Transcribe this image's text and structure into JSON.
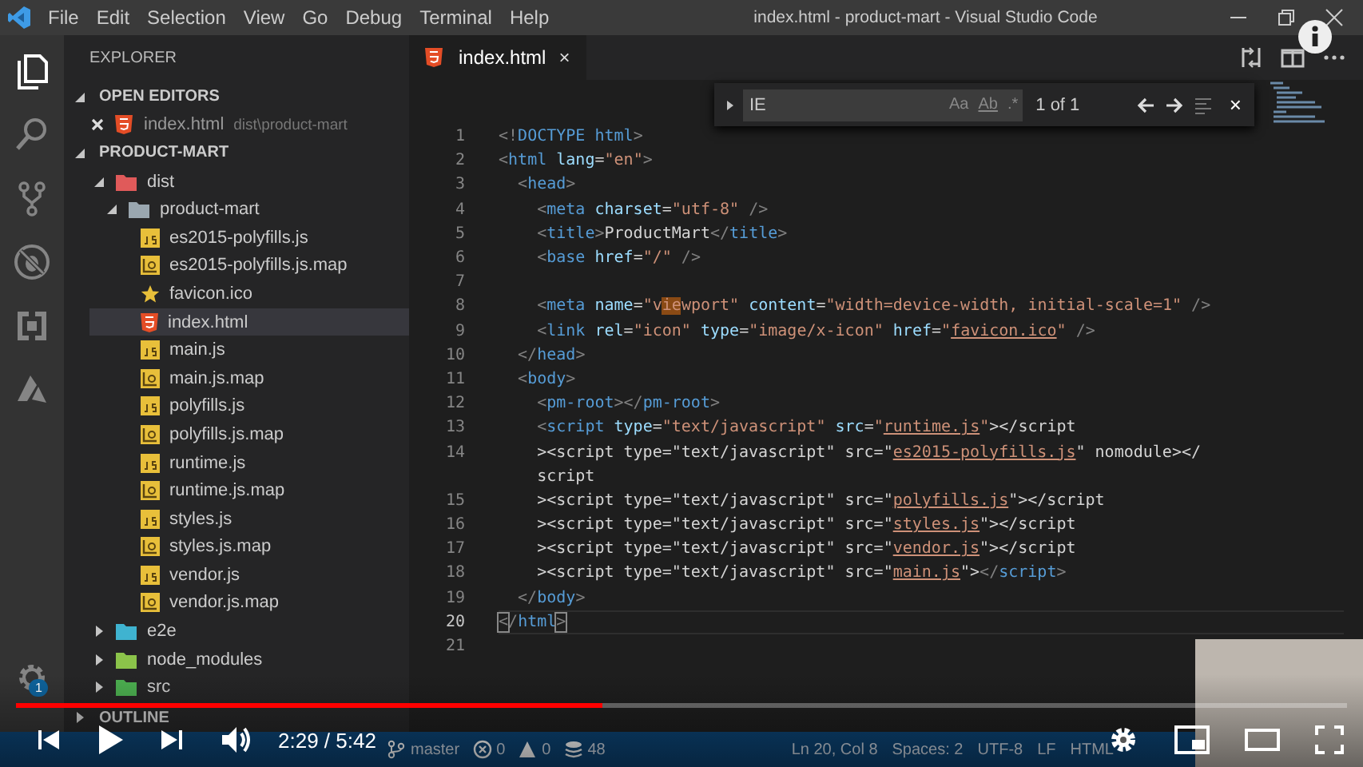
{
  "window": {
    "title": "index.html - product-mart - Visual Studio Code",
    "menu": [
      "File",
      "Edit",
      "Selection",
      "View",
      "Go",
      "Debug",
      "Terminal",
      "Help"
    ]
  },
  "activity_bar": {
    "items": [
      {
        "kind": "files",
        "selected": true
      },
      {
        "kind": "search",
        "selected": false
      },
      {
        "kind": "source-control",
        "selected": false
      },
      {
        "kind": "debug",
        "selected": false
      },
      {
        "kind": "extensions",
        "selected": false
      },
      {
        "kind": "azure",
        "selected": false
      }
    ],
    "settings_badge": "1"
  },
  "explorer": {
    "title": "EXPLORER",
    "open_editors": {
      "title": "OPEN EDITORS",
      "expanded": true,
      "items": [
        {
          "kind": "html",
          "name": "index.html",
          "path": "dist\\product-mart"
        }
      ]
    },
    "folder": {
      "title": "PRODUCT-MART",
      "expanded": true,
      "items": [
        {
          "kind": "folder",
          "name": "dist",
          "color": "#e05a5a",
          "expanded": true,
          "selected": false,
          "children": [
            {
              "kind": "folder",
              "name": "product-mart",
              "color": "#9aa7b0",
              "expanded": true,
              "selected": false,
              "children": [
                {
                  "kind": "js",
                  "name": "es2015-polyfills.js",
                  "selected": false
                },
                {
                  "kind": "map",
                  "name": "es2015-polyfills.js.map",
                  "selected": false
                },
                {
                  "kind": "favicon",
                  "name": "favicon.ico",
                  "selected": false
                },
                {
                  "kind": "html",
                  "name": "index.html",
                  "selected": true
                },
                {
                  "kind": "js",
                  "name": "main.js",
                  "selected": false
                },
                {
                  "kind": "map",
                  "name": "main.js.map",
                  "selected": false
                },
                {
                  "kind": "js",
                  "name": "polyfills.js",
                  "selected": false
                },
                {
                  "kind": "map",
                  "name": "polyfills.js.map",
                  "selected": false
                },
                {
                  "kind": "js",
                  "name": "runtime.js",
                  "selected": false
                },
                {
                  "kind": "map",
                  "name": "runtime.js.map",
                  "selected": false
                },
                {
                  "kind": "js",
                  "name": "styles.js",
                  "selected": false
                },
                {
                  "kind": "map",
                  "name": "styles.js.map",
                  "selected": false
                },
                {
                  "kind": "js",
                  "name": "vendor.js",
                  "selected": false
                },
                {
                  "kind": "map",
                  "name": "vendor.js.map",
                  "selected": false
                }
              ]
            }
          ]
        },
        {
          "kind": "folder",
          "name": "e2e",
          "color": "#3fb3d0",
          "expanded": false,
          "selected": false
        },
        {
          "kind": "folder",
          "name": "node_modules",
          "color": "#8bc34a",
          "expanded": false,
          "selected": false
        },
        {
          "kind": "folder",
          "name": "src",
          "color": "#4caf50",
          "expanded": false,
          "selected": false
        }
      ]
    },
    "outline": {
      "title": "OUTLINE",
      "expanded": false
    }
  },
  "editor": {
    "tabs": [
      {
        "kind": "html",
        "label": "index.html",
        "selected": true,
        "close": "×"
      }
    ],
    "find": {
      "query": "IE",
      "options": [
        "Aa",
        "Ab",
        ".*"
      ],
      "result": "1 of 1",
      "close": "×"
    },
    "lines": [
      {
        "number": "1",
        "current": false,
        "tokens": [
          {
            "kind": "p",
            "text": "<!"
          },
          {
            "kind": "tag",
            "text": "DOCTYPE"
          },
          {
            "kind": "tag",
            "text": " html"
          },
          {
            "kind": "p",
            "text": ">"
          }
        ]
      },
      {
        "number": "2",
        "current": false,
        "tokens": [
          {
            "kind": "p",
            "text": "<"
          },
          {
            "kind": "tag",
            "text": "html"
          },
          {
            "kind": "attr",
            "text": " lang"
          },
          {
            "kind": "t",
            "text": "="
          },
          {
            "kind": "str",
            "text": "\"en\""
          },
          {
            "kind": "p",
            "text": ">"
          }
        ]
      },
      {
        "number": "3",
        "current": false,
        "tokens": [
          {
            "kind": "p",
            "text": "  <"
          },
          {
            "kind": "tag",
            "text": "head"
          },
          {
            "kind": "p",
            "text": ">"
          }
        ]
      },
      {
        "number": "4",
        "current": false,
        "tokens": [
          {
            "kind": "p",
            "text": "    <"
          },
          {
            "kind": "tag",
            "text": "meta"
          },
          {
            "kind": "attr",
            "text": " charset"
          },
          {
            "kind": "t",
            "text": "="
          },
          {
            "kind": "str",
            "text": "\"utf-8\""
          },
          {
            "kind": "p",
            "text": " />"
          }
        ]
      },
      {
        "number": "5",
        "current": false,
        "tokens": [
          {
            "kind": "p",
            "text": "    <"
          },
          {
            "kind": "tag",
            "text": "title"
          },
          {
            "kind": "p",
            "text": ">"
          },
          {
            "kind": "t",
            "text": "ProductMart"
          },
          {
            "kind": "p",
            "text": "</"
          },
          {
            "kind": "tag",
            "text": "title"
          },
          {
            "kind": "p",
            "text": ">"
          }
        ]
      },
      {
        "number": "6",
        "current": false,
        "tokens": [
          {
            "kind": "p",
            "text": "    <"
          },
          {
            "kind": "tag",
            "text": "base"
          },
          {
            "kind": "attr",
            "text": " href"
          },
          {
            "kind": "t",
            "text": "="
          },
          {
            "kind": "str",
            "text": "\"/\""
          },
          {
            "kind": "p",
            "text": " />"
          }
        ]
      },
      {
        "number": "7",
        "current": false
      },
      {
        "number": "8",
        "current": false,
        "tokens": [
          {
            "kind": "p",
            "text": "    <"
          },
          {
            "kind": "tag",
            "text": "meta"
          },
          {
            "kind": "attr",
            "text": " name"
          },
          {
            "kind": "t",
            "text": "="
          },
          {
            "kind": "str",
            "text": "\"v"
          },
          {
            "kind": "match",
            "text": "ie"
          },
          {
            "kind": "str",
            "text": "wport\""
          },
          {
            "kind": "attr",
            "text": " content"
          },
          {
            "kind": "t",
            "text": "="
          },
          {
            "kind": "str",
            "text": "\"width=device-width, initial-scale=1\""
          },
          {
            "kind": "p",
            "text": " />"
          }
        ]
      },
      {
        "number": "9",
        "current": false,
        "tokens": [
          {
            "kind": "p",
            "text": "    <"
          },
          {
            "kind": "tag",
            "text": "link"
          },
          {
            "kind": "attr",
            "text": " rel"
          },
          {
            "kind": "t",
            "text": "="
          },
          {
            "kind": "str",
            "text": "\"icon\""
          },
          {
            "kind": "attr",
            "text": " type"
          },
          {
            "kind": "t",
            "text": "="
          },
          {
            "kind": "str",
            "text": "\"image/x-icon\""
          },
          {
            "kind": "attr",
            "text": " href"
          },
          {
            "kind": "t",
            "text": "="
          },
          {
            "kind": "str",
            "text": "\""
          },
          {
            "kind": "link",
            "text": "favicon.ico"
          },
          {
            "kind": "str",
            "text": "\""
          },
          {
            "kind": "p",
            "text": " />"
          }
        ]
      },
      {
        "number": "10",
        "current": false,
        "tokens": [
          {
            "kind": "p",
            "text": "  </"
          },
          {
            "kind": "tag",
            "text": "head"
          },
          {
            "kind": "p",
            "text": ">"
          }
        ]
      },
      {
        "number": "11",
        "current": false,
        "tokens": [
          {
            "kind": "p",
            "text": "  <"
          },
          {
            "kind": "tag",
            "text": "body"
          },
          {
            "kind": "p",
            "text": ">"
          }
        ]
      },
      {
        "number": "12",
        "current": false,
        "tokens": [
          {
            "kind": "p",
            "text": "    <"
          },
          {
            "kind": "tag",
            "text": "pm-root"
          },
          {
            "kind": "p",
            "text": "></"
          },
          {
            "kind": "tag",
            "text": "pm-root"
          },
          {
            "kind": "p",
            "text": ">"
          }
        ]
      },
      {
        "number": "13",
        "current": false,
        "tokens": [
          {
            "kind": "p",
            "text": "    <"
          },
          {
            "kind": "tag",
            "text": "script"
          },
          {
            "kind": "attr",
            "text": " type"
          },
          {
            "kind": "t",
            "text": "="
          },
          {
            "kind": "str",
            "text": "\"text/javascript\""
          },
          {
            "kind": "attr",
            "text": " src"
          },
          {
            "kind": "t",
            "text": "="
          },
          {
            "kind": "str",
            "text": "\""
          },
          {
            "kind": "link",
            "text": "runtime.js"
          },
          {
            "kind": "str",
            "text": "\""
          },
          {
            "kind": "t",
            "text": "></script"
          }
        ]
      },
      {
        "number": "14",
        "current": false,
        "tokens": [
          {
            "kind": "t",
            "text": "    ><script type=\"text/javascript\" src=\""
          },
          {
            "kind": "link",
            "text": "es2015-polyfills.js"
          },
          {
            "kind": "t",
            "text": "\" nomodule></"
          }
        ]
      },
      {
        "current": false,
        "tokens": [
          {
            "kind": "t",
            "text": "    script"
          }
        ]
      },
      {
        "number": "15",
        "current": false,
        "tokens": [
          {
            "kind": "t",
            "text": "    ><script type=\"text/javascript\" src=\""
          },
          {
            "kind": "link",
            "text": "polyfills.js"
          },
          {
            "kind": "t",
            "text": "\"></script"
          }
        ]
      },
      {
        "number": "16",
        "current": false,
        "tokens": [
          {
            "kind": "t",
            "text": "    ><script type=\"text/javascript\" src=\""
          },
          {
            "kind": "link",
            "text": "styles.js"
          },
          {
            "kind": "t",
            "text": "\"></script"
          }
        ]
      },
      {
        "number": "17",
        "current": false,
        "tokens": [
          {
            "kind": "t",
            "text": "    ><script type=\"text/javascript\" src=\""
          },
          {
            "kind": "link",
            "text": "vendor.js"
          },
          {
            "kind": "t",
            "text": "\"></script"
          }
        ]
      },
      {
        "number": "18",
        "current": false,
        "tokens": [
          {
            "kind": "t",
            "text": "    ><script type=\"text/javascript\" src=\""
          },
          {
            "kind": "link",
            "text": "main.js"
          },
          {
            "kind": "t",
            "text": "\">"
          },
          {
            "kind": "p",
            "text": "</"
          },
          {
            "kind": "tag",
            "text": "script"
          },
          {
            "kind": "p",
            "text": ">"
          }
        ]
      },
      {
        "number": "19",
        "current": false,
        "tokens": [
          {
            "kind": "p",
            "text": "  </"
          },
          {
            "kind": "tag",
            "text": "body"
          },
          {
            "kind": "p",
            "text": ">"
          }
        ]
      },
      {
        "number": "20",
        "current": true,
        "tokens": [
          {
            "kind": "bracket",
            "text": "<"
          },
          {
            "kind": "p",
            "text": "/"
          },
          {
            "kind": "tag",
            "text": "html"
          },
          {
            "kind": "bracket",
            "text": ">"
          }
        ]
      },
      {
        "number": "21",
        "current": false
      }
    ]
  },
  "status_bar": {
    "left": [
      {
        "kind": "branch",
        "text": "master"
      },
      {
        "kind": "errors",
        "text": "0"
      },
      {
        "kind": "warnings",
        "text": "0"
      },
      {
        "kind": "stack",
        "text": "48"
      }
    ],
    "right": [
      "Ln 20, Col 8",
      "Spaces: 2",
      "UTF-8",
      "LF",
      "HTML"
    ]
  },
  "player": {
    "level": 0.44,
    "time": "2:29 / 5:42"
  }
}
